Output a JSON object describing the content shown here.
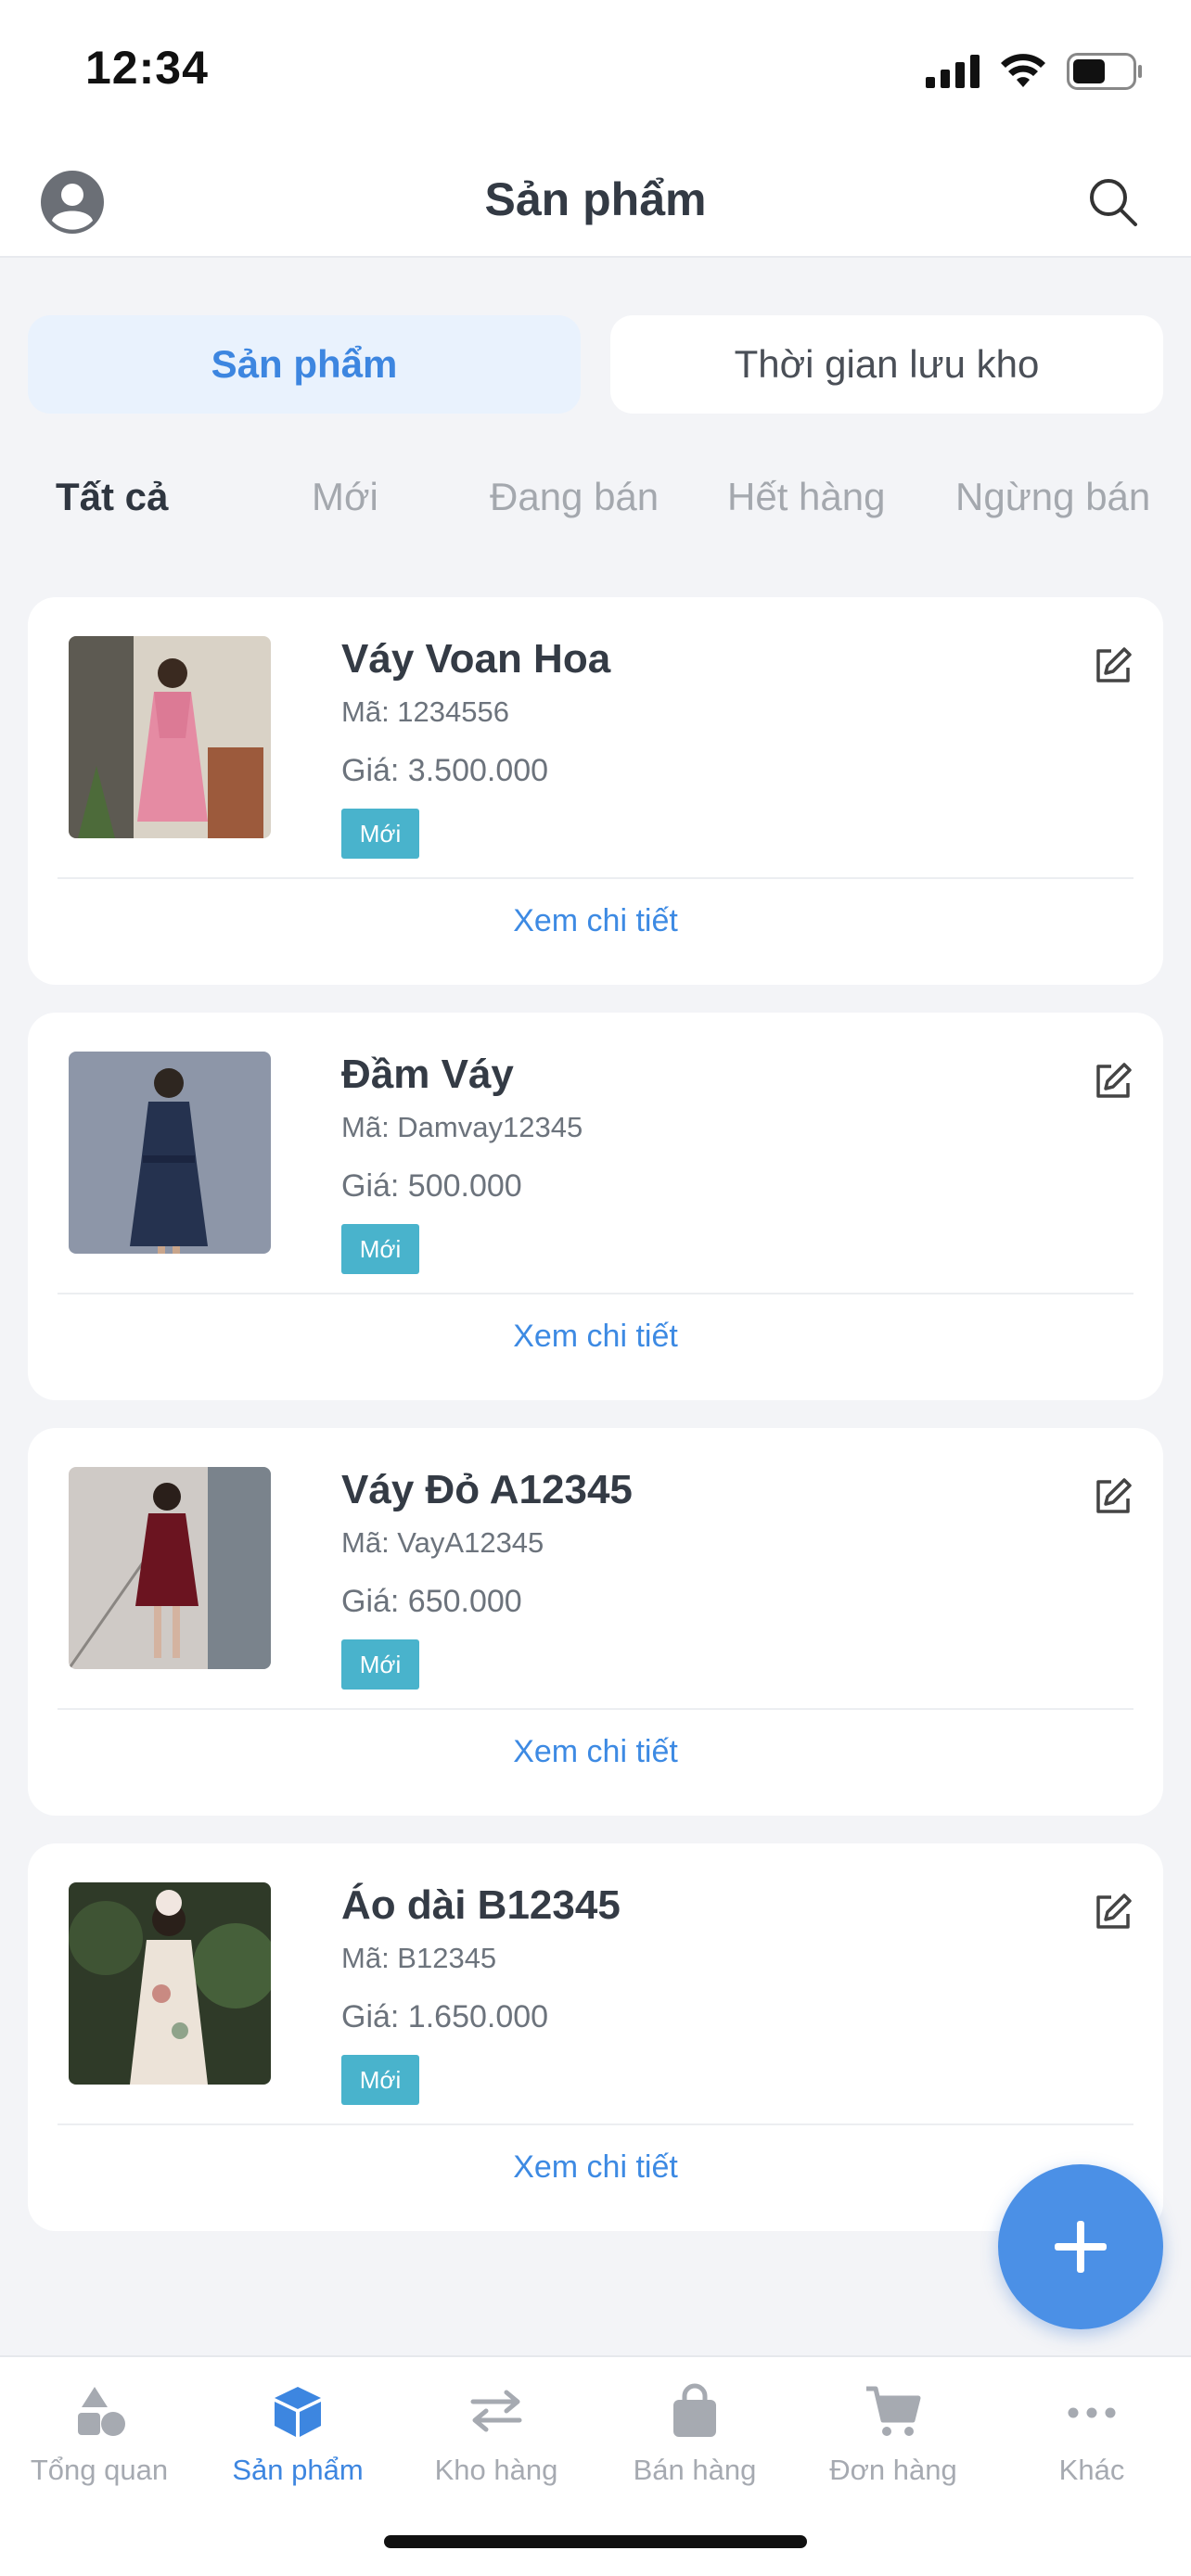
{
  "status_bar": {
    "time": "12:34"
  },
  "header": {
    "title": "Sản phẩm"
  },
  "segments": [
    {
      "label": "Sản phẩm",
      "active": true
    },
    {
      "label": "Thời gian lưu kho",
      "active": false
    }
  ],
  "filters": [
    {
      "label": "Tất cả",
      "active": true
    },
    {
      "label": "Mới",
      "active": false
    },
    {
      "label": "Đang bán",
      "active": false
    },
    {
      "label": "Hết hàng",
      "active": false
    },
    {
      "label": "Ngừng bán",
      "active": false
    }
  ],
  "products": [
    {
      "name": "Váy Voan Hoa",
      "code": "Mã: 1234556",
      "price": "Giá: 3.500.000",
      "badge": "Mới",
      "link": "Xem chi tiết"
    },
    {
      "name": "Đầm Váy",
      "code": "Mã: Damvay12345",
      "price": "Giá: 500.000",
      "badge": "Mới",
      "link": "Xem chi tiết"
    },
    {
      "name": "Váy Đỏ A12345",
      "code": "Mã: VayA12345",
      "price": "Giá: 650.000",
      "badge": "Mới",
      "link": "Xem chi tiết"
    },
    {
      "name": "Áo dài B12345",
      "code": "Mã: B12345",
      "price": "Giá: 1.650.000",
      "badge": "Mới",
      "link": "Xem chi tiết"
    }
  ],
  "bottom_nav": [
    {
      "label": "Tổng quan",
      "icon": "shapes-icon",
      "active": false
    },
    {
      "label": "Sản phẩm",
      "icon": "box-icon",
      "active": true
    },
    {
      "label": "Kho hàng",
      "icon": "transfer-arrows-icon",
      "active": false
    },
    {
      "label": "Bán hàng",
      "icon": "shopping-bag-icon",
      "active": false
    },
    {
      "label": "Đơn hàng",
      "icon": "cart-icon",
      "active": false
    },
    {
      "label": "Khác",
      "icon": "more-dots-icon",
      "active": false
    }
  ],
  "colors": {
    "accent": "#3d86e0",
    "badge": "#49b3cc",
    "fab": "#4b90e6",
    "background": "#f3f4f7"
  }
}
